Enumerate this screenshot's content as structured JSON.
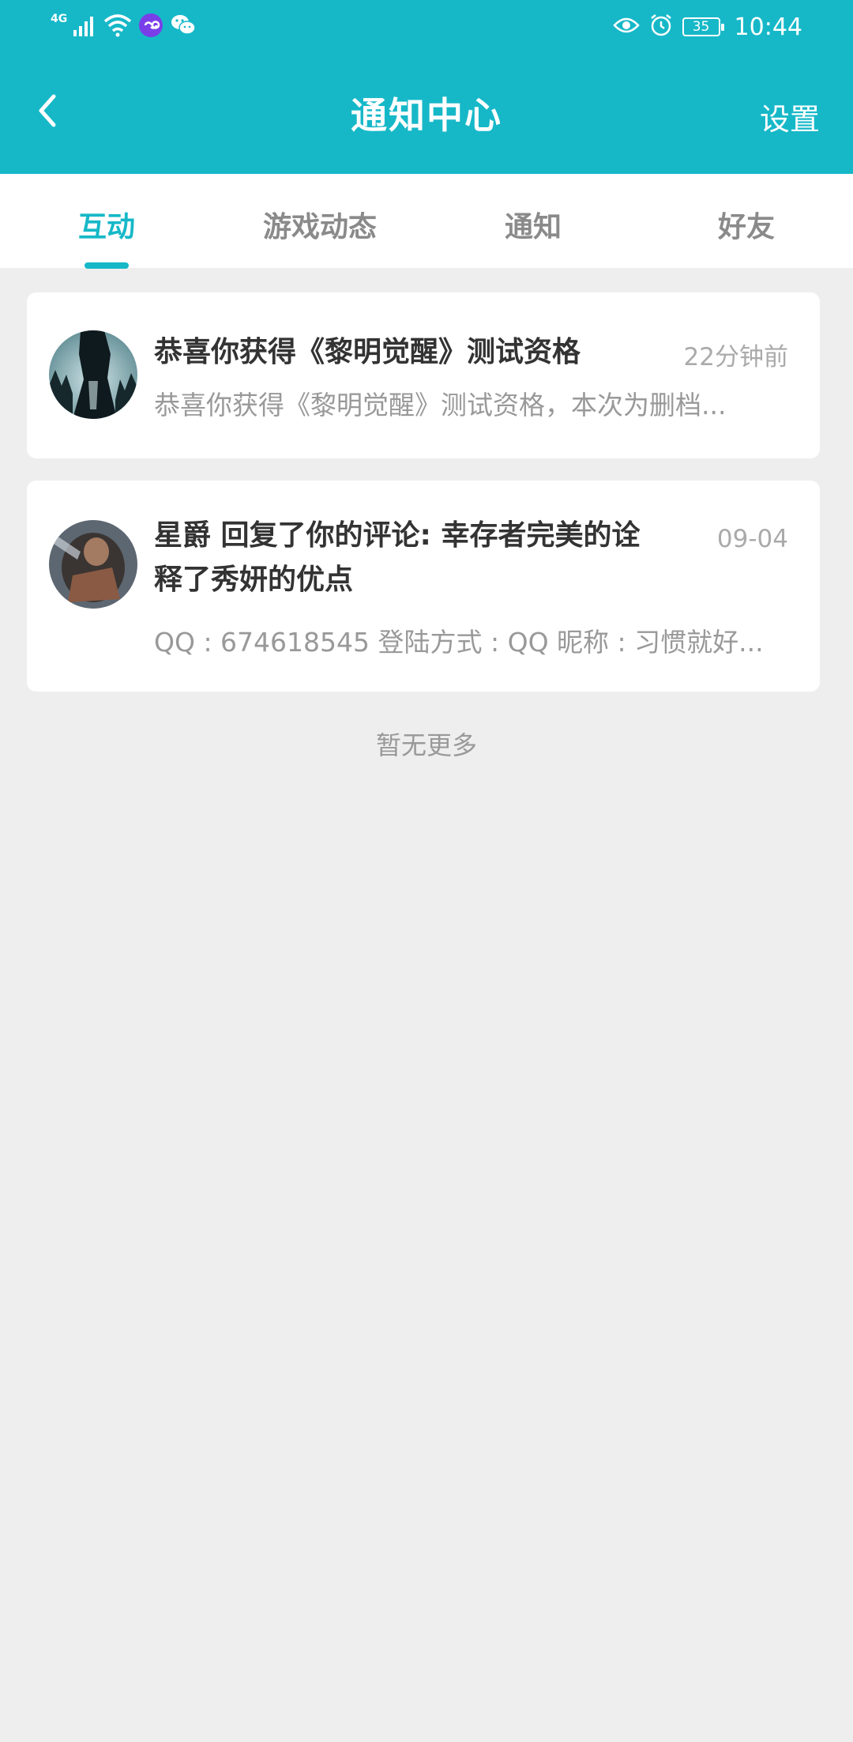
{
  "status_bar": {
    "network": "4G",
    "battery": "35",
    "time": "10:44"
  },
  "app_bar": {
    "title": "通知中心",
    "settings_label": "设置"
  },
  "tabs": [
    {
      "label": "互动",
      "active": true
    },
    {
      "label": "游戏动态",
      "active": false
    },
    {
      "label": "通知",
      "active": false
    },
    {
      "label": "好友",
      "active": false
    }
  ],
  "notifications": [
    {
      "title": "恭喜你获得《黎明觉醒》测试资格",
      "time": "22分钟前",
      "preview": "恭喜你获得《黎明觉醒》测试资格，本次为删档..."
    },
    {
      "title_line1": "星爵 回复了你的评论: 幸存者完美的诠",
      "title_line2": "释了秀妍的优点",
      "time": "09-04",
      "preview": "QQ : 674618545 登陆方式 : QQ 昵称 : 习惯就好..."
    }
  ],
  "footer": {
    "no_more": "暂无更多"
  },
  "colors": {
    "accent": "#16b8c8",
    "background": "#eeeeee"
  }
}
